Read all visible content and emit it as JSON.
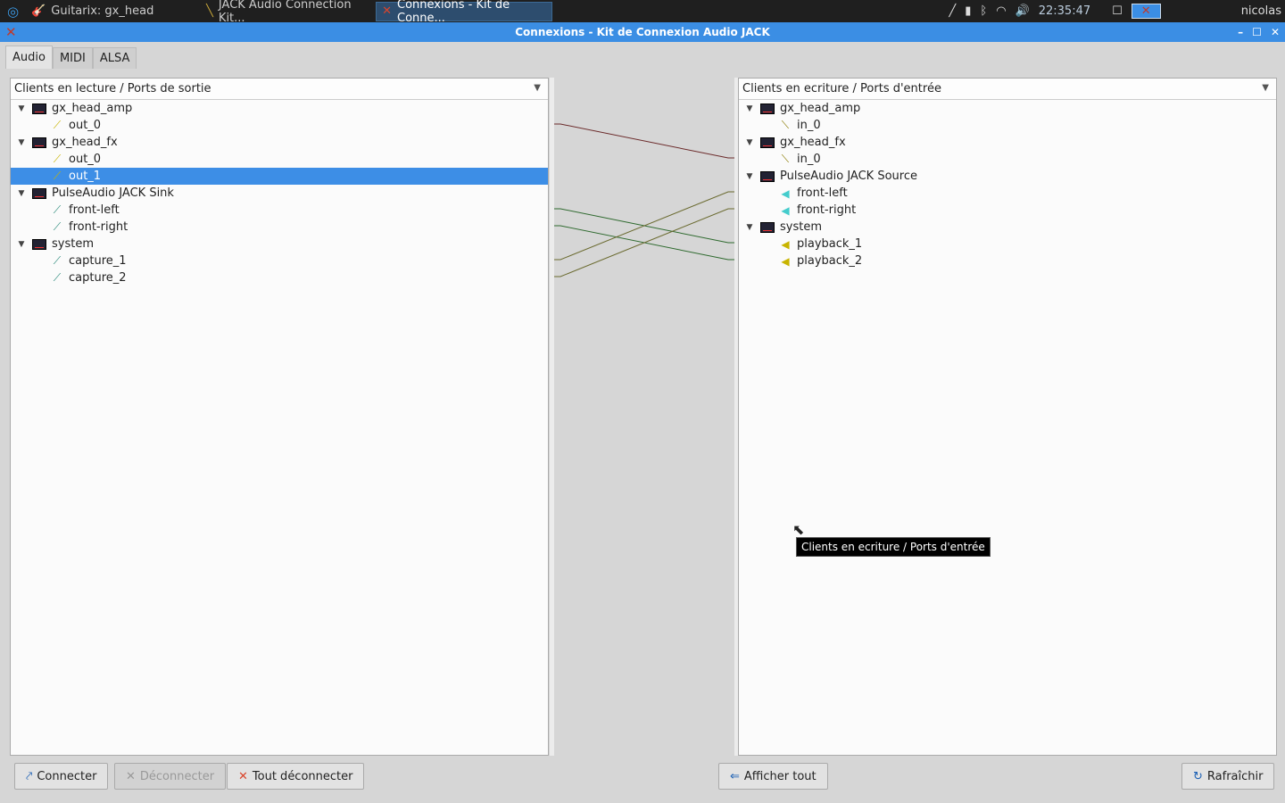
{
  "taskbar": {
    "tasks": [
      {
        "label": "Guitarix: gx_head"
      },
      {
        "label": "JACK Audio Connection Kit..."
      },
      {
        "label": "Connexions - Kit de Conne..."
      }
    ],
    "clock": "22:35:47",
    "user": "nicolas"
  },
  "window": {
    "title": "Connexions - Kit de Connexion Audio JACK"
  },
  "tabs": [
    {
      "label": "Audio"
    },
    {
      "label": "MIDI"
    },
    {
      "label": "ALSA"
    }
  ],
  "left": {
    "header": "Clients en lecture / Ports de sortie",
    "clients": [
      {
        "name": "gx_head_amp",
        "ports": [
          "out_0"
        ]
      },
      {
        "name": "gx_head_fx",
        "ports": [
          "out_0",
          "out_1"
        ]
      },
      {
        "name": "PulseAudio JACK Sink",
        "ports": [
          "front-left",
          "front-right"
        ]
      },
      {
        "name": "system",
        "ports": [
          "capture_1",
          "capture_2"
        ]
      }
    ],
    "selected": "gx_head_fx/out_1"
  },
  "right": {
    "header": "Clients en ecriture / Ports d'entrée",
    "clients": [
      {
        "name": "gx_head_amp",
        "ports": [
          "in_0"
        ]
      },
      {
        "name": "gx_head_fx",
        "ports": [
          "in_0"
        ]
      },
      {
        "name": "PulseAudio JACK Source",
        "ports": [
          "front-left",
          "front-right"
        ]
      },
      {
        "name": "system",
        "ports": [
          "playback_1",
          "playback_2"
        ]
      }
    ]
  },
  "connections": [
    {
      "from": "gx_head_amp/out_0",
      "to": "gx_head_fx/in_0",
      "color": "#6b2a2a"
    },
    {
      "from": "PulseAudio JACK Sink/front-left",
      "to": "system/playback_1",
      "color": "#2f6a2f"
    },
    {
      "from": "PulseAudio JACK Sink/front-right",
      "to": "system/playback_2",
      "color": "#2f6a2f"
    },
    {
      "from": "system/capture_1",
      "to": "PulseAudio JACK Source/front-left",
      "color": "#6a6a2f"
    },
    {
      "from": "system/capture_2",
      "to": "PulseAudio JACK Source/front-right",
      "color": "#6a6a2f"
    }
  ],
  "buttons": {
    "connect": "Connecter",
    "disconnect": "Déconnecter",
    "disconnect_all": "Tout déconnecter",
    "expand_all": "Afficher tout",
    "refresh": "Rafraîchir"
  },
  "tooltip": "Clients en ecriture / Ports d'entrée"
}
